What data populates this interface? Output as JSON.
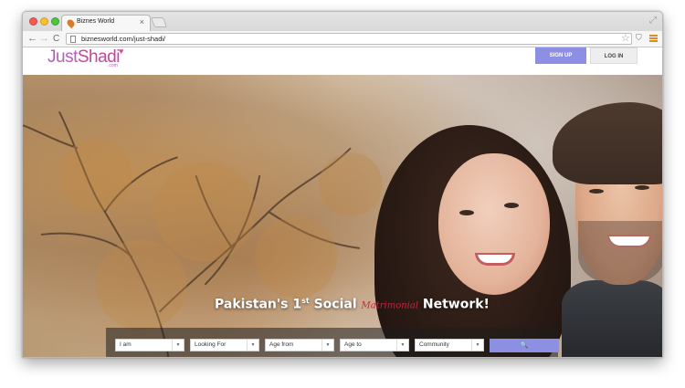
{
  "browser": {
    "tab_title": "Biznes World",
    "tab_close": "×",
    "url": "biznesworld.com/just-shadi/",
    "nav": {
      "back": "←",
      "forward": "→",
      "reload": "C"
    },
    "icons": {
      "star": "☆",
      "extension": "⛉",
      "resize": "⤢"
    }
  },
  "site": {
    "logo": {
      "first": "Just",
      "second": "Shadi",
      "heart": "♥",
      "sub": ".com"
    },
    "signup_label": "SIGN UP",
    "login_label": "LOG IN"
  },
  "hero": {
    "tagline_pre": "Pakistan's 1",
    "tagline_sup": "st",
    "tagline_social": " Social ",
    "tagline_script": "Matrimonial",
    "tagline_post": " Network!"
  },
  "search": {
    "i_am": "I am",
    "looking_for": "Looking For",
    "age_from": "Age from",
    "age_to": "Age to",
    "community": "Community",
    "caret": "▼",
    "button_icon": "🔍"
  },
  "colors": {
    "accent": "#8d8fe3",
    "logo": "#b55ebf",
    "tagline_script": "#c8243c"
  }
}
